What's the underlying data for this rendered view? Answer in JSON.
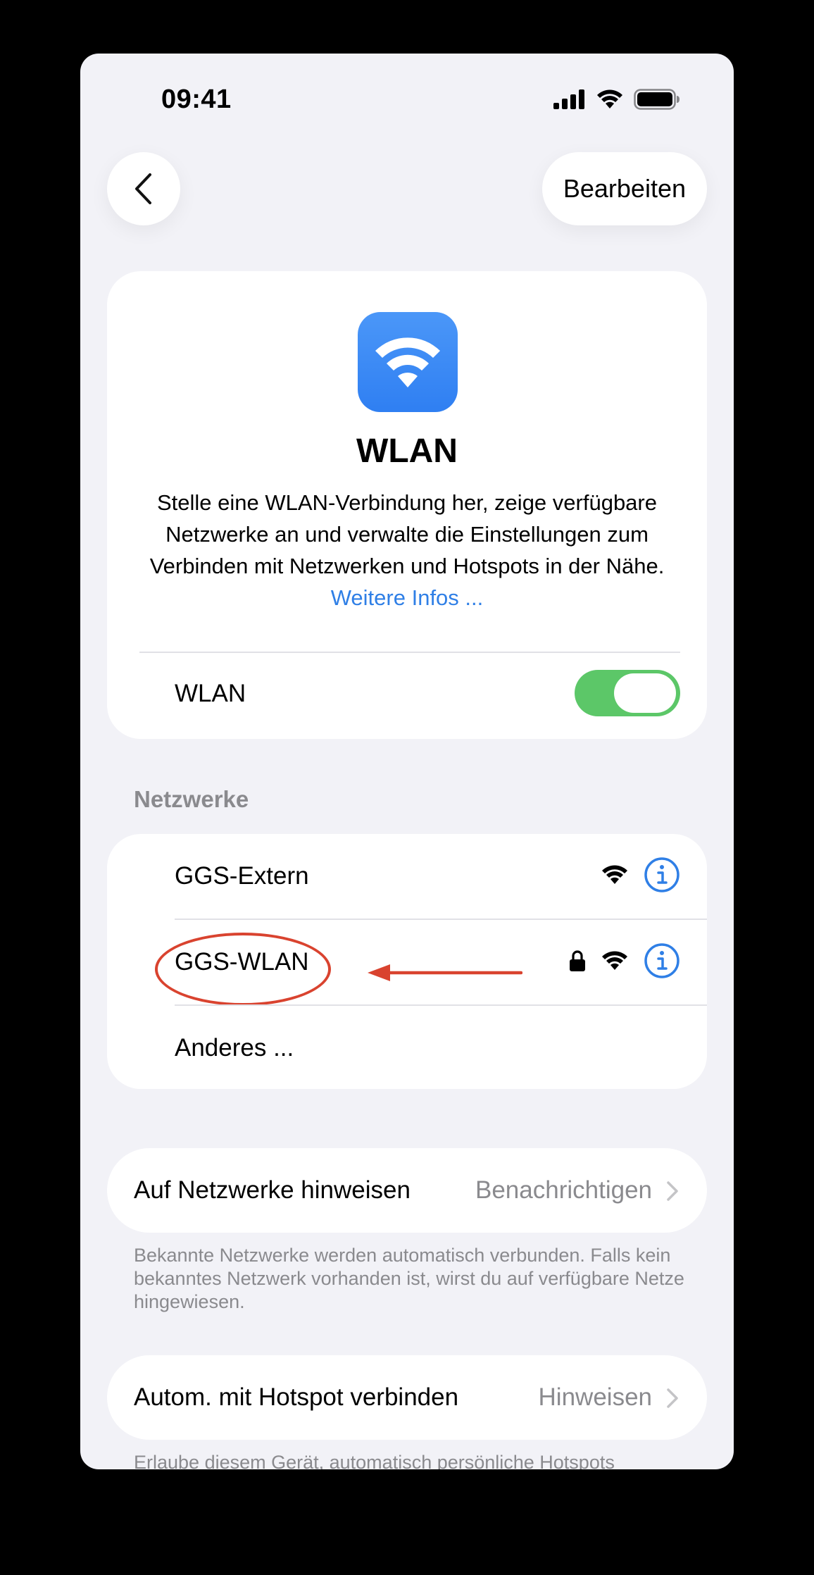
{
  "status_bar": {
    "time": "09:41"
  },
  "nav": {
    "edit_label": "Bearbeiten"
  },
  "header": {
    "title": "WLAN",
    "description": "Stelle eine WLAN-Verbindung her, zeige verfügbare Netzwerke an und verwalte die Einstellungen zum Verbinden mit Netzwerken und Hotspots in der Nähe.",
    "link": "Weitere Infos ...",
    "wlan_toggle_label": "WLAN",
    "wlan_toggle_on": true
  },
  "networks": {
    "section_title": "Netzwerke",
    "items": [
      {
        "name": "GGS-Extern",
        "locked": false
      },
      {
        "name": "GGS-WLAN",
        "locked": true,
        "highlighted": true
      },
      {
        "name": "Anderes ..."
      }
    ]
  },
  "ask_to_join": {
    "label": "Auf Netzwerke hinweisen",
    "value": "Benachrichtigen",
    "footnote": "Bekannte Netzwerke werden automatisch verbunden. Falls kein bekanntes Netzwerk vorhanden ist, wirst du auf verfügbare Netze hingewiesen."
  },
  "auto_hotspot": {
    "label": "Autom. mit Hotspot verbinden",
    "value": "Hinweisen",
    "footnote": "Erlaube diesem Gerät, automatisch persönliche Hotspots"
  },
  "colors": {
    "accent": "#2f7fe6",
    "toggle_on": "#5cc768",
    "annotation": "#d9432f",
    "background": "#f2f2f7"
  }
}
